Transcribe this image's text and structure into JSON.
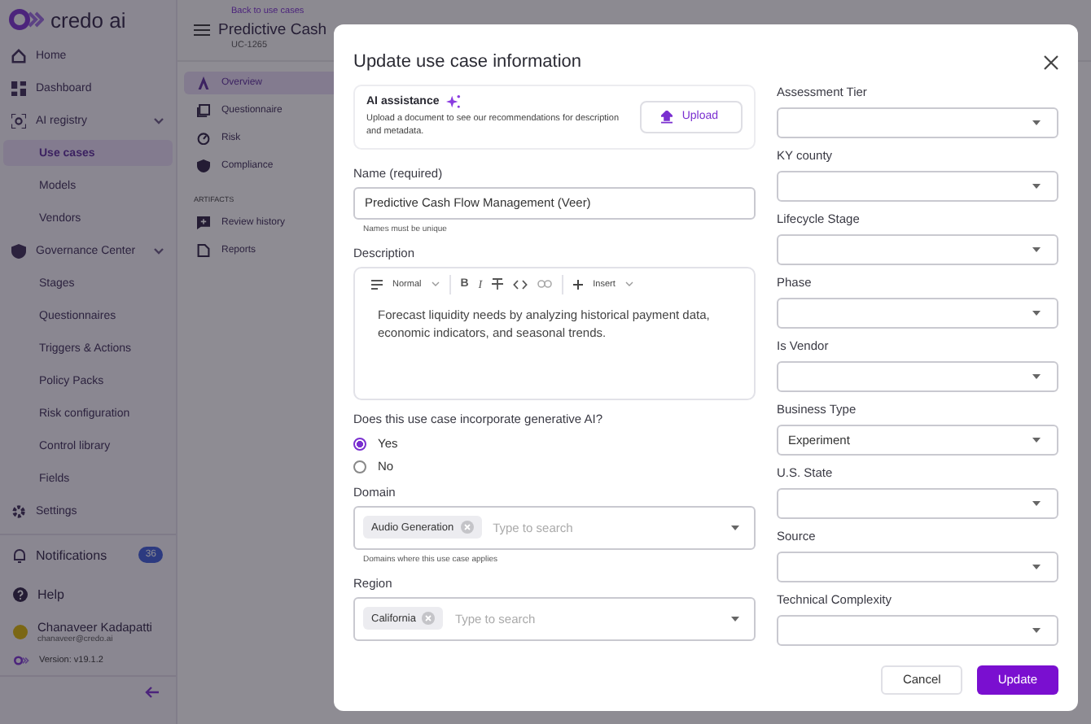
{
  "sidebar": {
    "logo": "credo ai",
    "items": [
      {
        "label": "Home",
        "selected": false
      },
      {
        "label": "Dashboard",
        "selected": false
      },
      {
        "label": "AI registry",
        "selected": false,
        "expanded": true,
        "children": [
          {
            "label": "Use cases",
            "selected": true
          },
          {
            "label": "Models",
            "selected": false
          },
          {
            "label": "Vendors",
            "selected": false
          }
        ]
      },
      {
        "label": "Governance Center",
        "selected": false,
        "expanded": true,
        "children": [
          {
            "label": "Stages",
            "selected": false
          },
          {
            "label": "Questionnaires",
            "selected": false
          },
          {
            "label": "Triggers & Actions",
            "selected": false
          },
          {
            "label": "Policy Packs",
            "selected": false
          },
          {
            "label": "Risk configuration",
            "selected": false
          },
          {
            "label": "Control library",
            "selected": false
          },
          {
            "label": "Fields",
            "selected": false
          }
        ]
      },
      {
        "label": "Settings",
        "selected": false
      }
    ],
    "notifications": {
      "label": "Notifications",
      "badge": "36"
    },
    "help": "Help",
    "user": {
      "name": "Chanaveer Kadapatti",
      "email": "chanaveer@credo.ai"
    },
    "version": "Version: v19.1.2"
  },
  "page": {
    "back_link": "Back to use cases",
    "title": "Predictive Cash",
    "id": "UC-1265",
    "nav": [
      {
        "label": "Overview",
        "selected": true
      },
      {
        "label": "Questionnaire",
        "selected": false
      },
      {
        "label": "Risk",
        "selected": false
      },
      {
        "label": "Compliance",
        "selected": false
      }
    ],
    "artifacts_heading": "ARTIFACTS",
    "artifacts": [
      {
        "label": "Review history",
        "selected": false
      },
      {
        "label": "Reports",
        "selected": false
      }
    ]
  },
  "dialog": {
    "title": "Update use case information",
    "ai_assistance": {
      "title": "AI assistance",
      "description": "Upload a document to see our recommendations for description and metadata.",
      "button": "Upload"
    },
    "name": {
      "label": "Name (required)",
      "value": "Predictive Cash Flow Management (Veer)",
      "helper": "Names must be unique"
    },
    "description": {
      "label": "Description",
      "style": "Normal",
      "bold": "B",
      "italic": "I",
      "insert": "Insert",
      "value": "Forecast liquidity needs by analyzing historical payment data, economic indicators, and seasonal trends."
    },
    "generative_ai": {
      "label": "Does this use case incorporate generative AI?",
      "options": [
        {
          "label": "Yes",
          "selected": true
        },
        {
          "label": "No",
          "selected": false
        }
      ]
    },
    "domain": {
      "label": "Domain",
      "chips": [
        "Audio Generation"
      ],
      "placeholder": "Type to search",
      "helper": "Domains where this use case applies"
    },
    "region": {
      "label": "Region",
      "chips": [
        "California"
      ],
      "placeholder": "Type to search"
    },
    "selects": [
      {
        "label": "Assessment Tier"
      },
      {
        "label": "KY county"
      },
      {
        "label": "Lifecycle Stage"
      },
      {
        "label": "Phase"
      },
      {
        "label": "Is Vendor"
      },
      {
        "label": "Business Type",
        "value": "Experiment"
      },
      {
        "label": "U.S. State"
      },
      {
        "label": "Source"
      },
      {
        "label": "Technical Complexity"
      }
    ],
    "buttons": {
      "cancel": "Cancel",
      "submit": "Update"
    }
  }
}
